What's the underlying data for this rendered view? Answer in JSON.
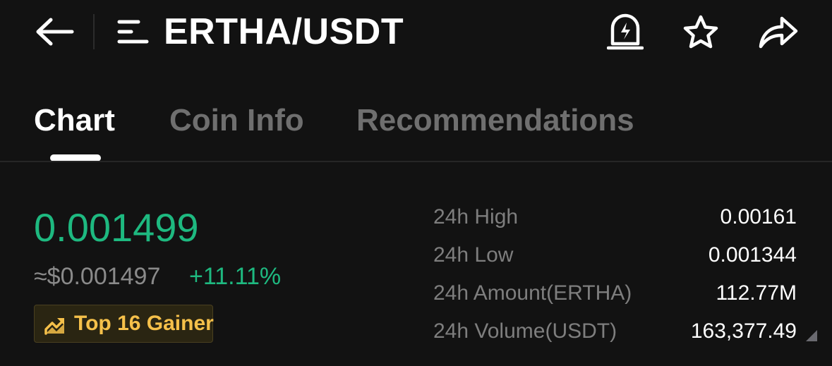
{
  "header": {
    "title": "ERTHA/USDT",
    "icons": [
      "arrow-left-icon",
      "list-menu-icon",
      "price-alert-bell-icon",
      "star-icon",
      "share-icon"
    ]
  },
  "tabs": [
    {
      "label": "Chart",
      "active": true
    },
    {
      "label": "Coin Info",
      "active": false
    },
    {
      "label": "Recommendations",
      "active": false
    }
  ],
  "ticker": {
    "price": "0.001499",
    "fiat_price": "≈$0.001497",
    "change": "+11.11%",
    "badge": "Top 16 Gainer"
  },
  "stats": [
    {
      "label": "24h High",
      "value": "0.00161"
    },
    {
      "label": "24h Low",
      "value": "0.001344"
    },
    {
      "label": "24h Amount(ERTHA)",
      "value": "112.77M"
    },
    {
      "label": "24h Volume(USDT)",
      "value": "163,377.49"
    }
  ],
  "colors": {
    "background": "#121212",
    "positive": "#1eb980",
    "badge_text": "#f5c04a",
    "muted": "#7e7e7e"
  }
}
